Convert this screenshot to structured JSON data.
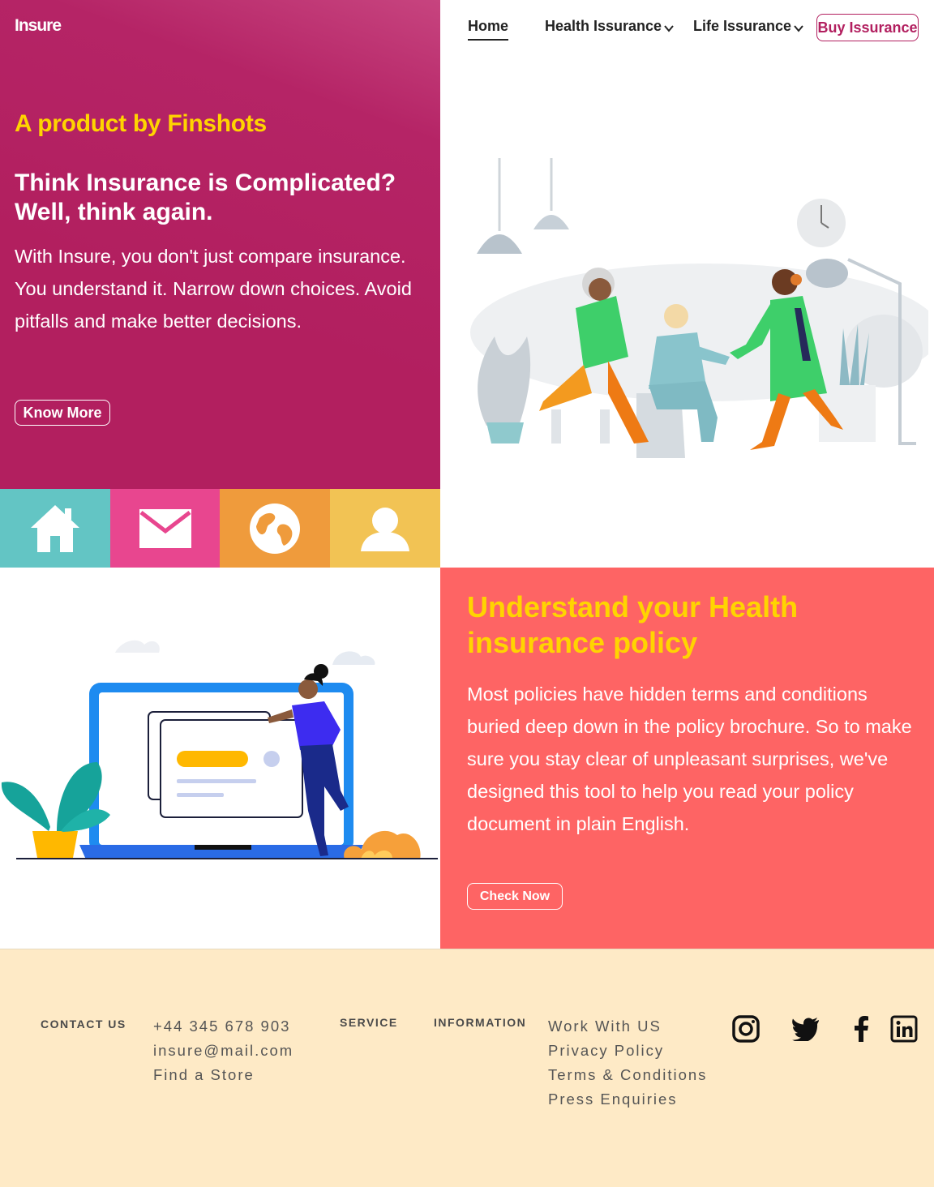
{
  "brand": {
    "logo": "Insure"
  },
  "nav": {
    "items": [
      {
        "label": "Home",
        "active": true
      },
      {
        "label": "Health Issurance",
        "has_dropdown": true
      },
      {
        "label": "Life Issurance",
        "has_dropdown": true
      }
    ],
    "cta": "Buy Issurance"
  },
  "hero": {
    "tagline": "A product by Finshots",
    "title": "Think Insurance is Complicated? Well, think again.",
    "body": "With Insure, you don't just compare insurance. You understand it. Narrow down choices. Avoid pitfalls and make better decisions.",
    "button": "Know More"
  },
  "tiles": [
    {
      "icon": "home-icon",
      "color": "#63c5c4"
    },
    {
      "icon": "mail-icon",
      "color": "#e8468f"
    },
    {
      "icon": "globe-icon",
      "color": "#ef9b3c"
    },
    {
      "icon": "user-icon",
      "color": "#f2c354"
    }
  ],
  "health": {
    "title": "Understand your Health insurance policy",
    "body": "Most policies have hidden terms and conditions buried deep down in the policy brochure. So to make sure you stay clear of unpleasant surprises, we've designed this tool to help you read your policy document in plain English.",
    "button": "Check Now"
  },
  "footer": {
    "contact": {
      "heading": "CONTACT US",
      "items": [
        "+44 345 678 903",
        "insure@mail.com",
        "Find a Store"
      ]
    },
    "service": {
      "heading": "SERVICE"
    },
    "information": {
      "heading": "INFORMATION",
      "items": [
        "Work With US",
        "Privacy Policy",
        "Terms & Conditions",
        "Press Enquiries"
      ]
    },
    "social": [
      "instagram-icon",
      "twitter-icon",
      "facebook-icon",
      "linkedin-icon"
    ]
  },
  "colors": {
    "brand_magenta": "#b21f5f",
    "accent_yellow": "#ffd400",
    "coral": "#fe6464",
    "footer_bg": "#feeac6"
  }
}
